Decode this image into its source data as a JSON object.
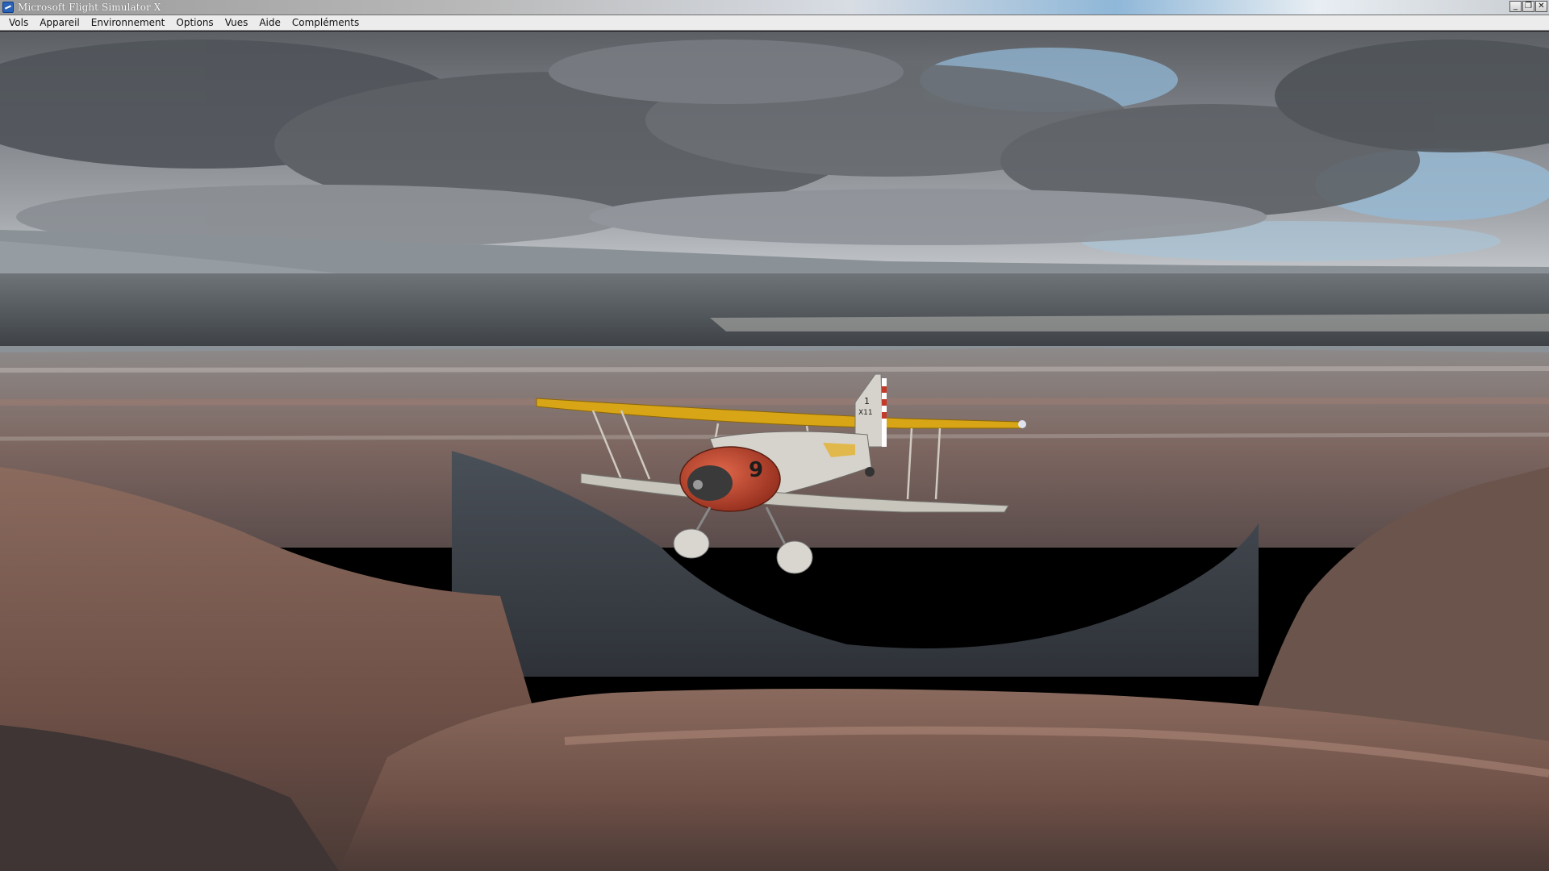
{
  "window": {
    "title": "Microsoft Flight Simulator X",
    "controls": {
      "minimize": "_",
      "restore": "❐",
      "close": "✕"
    }
  },
  "menu": {
    "items": [
      {
        "id": "vols",
        "label": "Vols"
      },
      {
        "id": "appareil",
        "label": "Appareil"
      },
      {
        "id": "environnement",
        "label": "Environnement"
      },
      {
        "id": "options",
        "label": "Options"
      },
      {
        "id": "vues",
        "label": "Vues"
      },
      {
        "id": "aide",
        "label": "Aide"
      },
      {
        "id": "complements",
        "label": "Compléments"
      }
    ]
  },
  "scene": {
    "aircraft": {
      "type_icon": "biplane-icon",
      "cowling_number": "9",
      "tail_marking_number": "1",
      "tail_marking_code": "X11",
      "colors": {
        "wing": "#d8a516",
        "fuselage": "#d6d3cc",
        "cowling": "#c8442a"
      }
    },
    "colors": {
      "sky_clouds": "#6a6d72",
      "sky_blue": "#8fb3cf",
      "canyon_rock": "#7a5a4e",
      "canyon_shadow": "#3d4249"
    }
  }
}
